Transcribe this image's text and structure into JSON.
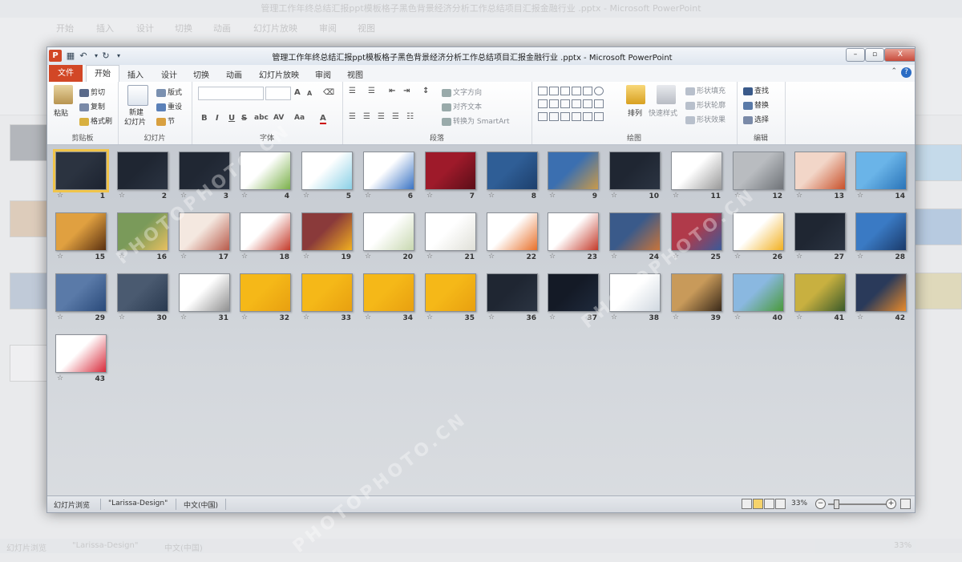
{
  "background_window": {
    "title": "管理工作年终总结汇报ppt模板格子黑色背景经济分析工作总结项目汇报金融行业 .pptx - Microsoft PowerPoint",
    "file_tab": "文件",
    "tabs": [
      "开始",
      "插入",
      "设计",
      "切换",
      "动画",
      "幻灯片放映",
      "审阅",
      "视图"
    ],
    "status": [
      "幻灯片浏览",
      "\"Larissa-Design\"",
      "中文(中国)"
    ],
    "zoom": "33%"
  },
  "window": {
    "title": "管理工作年终总结汇报ppt模板格子黑色背景经济分析工作总结项目汇报金融行业 .pptx - Microsoft PowerPoint",
    "app_icon": "P",
    "qat": [
      "save-icon",
      "undo-icon",
      "redo-icon",
      "customize-icon"
    ],
    "controls": {
      "minimize": "–",
      "restore": "▫",
      "close": "X"
    }
  },
  "ribbon_tabs": {
    "file": "文件",
    "tabs": [
      "开始",
      "插入",
      "设计",
      "切换",
      "动画",
      "幻灯片放映",
      "审阅",
      "视图"
    ],
    "active_index": 0
  },
  "ribbon": {
    "clipboard": {
      "label": "剪贴板",
      "paste": "粘贴",
      "cut": "剪切",
      "copy": "复制",
      "format_painter": "格式刷"
    },
    "slides": {
      "label": "幻灯片",
      "new_slide_line1": "新建",
      "new_slide_line2": "幻灯片",
      "layout": "版式",
      "reset": "重设",
      "section": "节"
    },
    "font": {
      "label": "字体",
      "grow": "A",
      "shrink": "A",
      "bold": "B",
      "italic": "I",
      "underline": "U",
      "strike": "S",
      "shadow": "abc",
      "spacing": "AV",
      "case": "Aa",
      "color": "A"
    },
    "paragraph": {
      "label": "段落",
      "text_direction": "文字方向",
      "align_text": "对齐文本",
      "smartart": "转换为 SmartArt"
    },
    "drawing": {
      "label": "绘图",
      "arrange": "排列",
      "quick_styles": "快速样式",
      "shape_fill": "形状填充",
      "shape_outline": "形状轮廓",
      "shape_effects": "形状效果"
    },
    "editing": {
      "label": "编辑",
      "find": "查找",
      "replace": "替换",
      "select": "选择"
    }
  },
  "slides": [
    {
      "n": "1",
      "c1": "#2b3340",
      "c2": "#1c2330",
      "selected": true
    },
    {
      "n": "2",
      "c1": "#1f2632",
      "c2": "#2b3442"
    },
    {
      "n": "3",
      "c1": "#202733",
      "c2": "#2a3240"
    },
    {
      "n": "4",
      "c1": "#ffffff",
      "c2": "#7bb04a"
    },
    {
      "n": "5",
      "c1": "#ffffff",
      "c2": "#8ad0e6"
    },
    {
      "n": "6",
      "c1": "#ffffff",
      "c2": "#3a74c4"
    },
    {
      "n": "7",
      "c1": "#9e1a2a",
      "c2": "#5a0e18"
    },
    {
      "n": "8",
      "c1": "#2f5e96",
      "c2": "#1d3f6c"
    },
    {
      "n": "9",
      "c1": "#3b6fb0",
      "c2": "#c99a4a"
    },
    {
      "n": "10",
      "c1": "#1f2632",
      "c2": "#2b3442"
    },
    {
      "n": "11",
      "c1": "#ffffff",
      "c2": "#999999"
    },
    {
      "n": "12",
      "c1": "#b9bcc0",
      "c2": "#6f7378"
    },
    {
      "n": "13",
      "c1": "#f2d6c8",
      "c2": "#c8502a"
    },
    {
      "n": "14",
      "c1": "#6ab4e8",
      "c2": "#2a74b8"
    },
    {
      "n": "15",
      "c1": "#e0a040",
      "c2": "#5a3010"
    },
    {
      "n": "16",
      "c1": "#7a9a5a",
      "c2": "#e8c060"
    },
    {
      "n": "17",
      "c1": "#f4e8e0",
      "c2": "#b85a4a"
    },
    {
      "n": "18",
      "c1": "#ffffff",
      "c2": "#c43a2a"
    },
    {
      "n": "19",
      "c1": "#8a3a3a",
      "c2": "#f2b020"
    },
    {
      "n": "20",
      "c1": "#ffffff",
      "c2": "#c8d8b0"
    },
    {
      "n": "21",
      "c1": "#ffffff",
      "c2": "#e0e0d8"
    },
    {
      "n": "22",
      "c1": "#ffffff",
      "c2": "#e8702a"
    },
    {
      "n": "23",
      "c1": "#ffffff",
      "c2": "#c43a2a"
    },
    {
      "n": "24",
      "c1": "#3a5a8a",
      "c2": "#c8743a"
    },
    {
      "n": "25",
      "c1": "#b03a4a",
      "c2": "#3a5a9a"
    },
    {
      "n": "26",
      "c1": "#ffffff",
      "c2": "#f2b020"
    },
    {
      "n": "27",
      "c1": "#1f2632",
      "c2": "#2b3442"
    },
    {
      "n": "28",
      "c1": "#3a7ac4",
      "c2": "#1a3a6a"
    },
    {
      "n": "29",
      "c1": "#5a7aa8",
      "c2": "#2a4a7a"
    },
    {
      "n": "30",
      "c1": "#4a5a70",
      "c2": "#2a3a50"
    },
    {
      "n": "31",
      "c1": "#ffffff",
      "c2": "#909090"
    },
    {
      "n": "32",
      "c1": "#f5b818",
      "c2": "#e8a010"
    },
    {
      "n": "33",
      "c1": "#f5b818",
      "c2": "#e8a010"
    },
    {
      "n": "34",
      "c1": "#f5b818",
      "c2": "#e8a010"
    },
    {
      "n": "35",
      "c1": "#f5b818",
      "c2": "#e8a010"
    },
    {
      "n": "36",
      "c1": "#1f2632",
      "c2": "#2b3442"
    },
    {
      "n": "37",
      "c1": "#141a26",
      "c2": "#1f2a3c"
    },
    {
      "n": "38",
      "c1": "#ffffff",
      "c2": "#d0d8e0"
    },
    {
      "n": "39",
      "c1": "#c89a5a",
      "c2": "#3a2a1a"
    },
    {
      "n": "40",
      "c1": "#8ab8e0",
      "c2": "#4a9a3a"
    },
    {
      "n": "41",
      "c1": "#c8b040",
      "c2": "#3a5a2a"
    },
    {
      "n": "42",
      "c1": "#2a3a5a",
      "c2": "#e88a2a"
    },
    {
      "n": "43",
      "c1": "#ffffff",
      "c2": "#d82a3a"
    }
  ],
  "status": {
    "view": "幻灯片浏览",
    "theme": "\"Larissa-Design\"",
    "language": "中文(中国)",
    "zoom": "33%"
  },
  "watermark": "PHOTOPHOTO.CN"
}
